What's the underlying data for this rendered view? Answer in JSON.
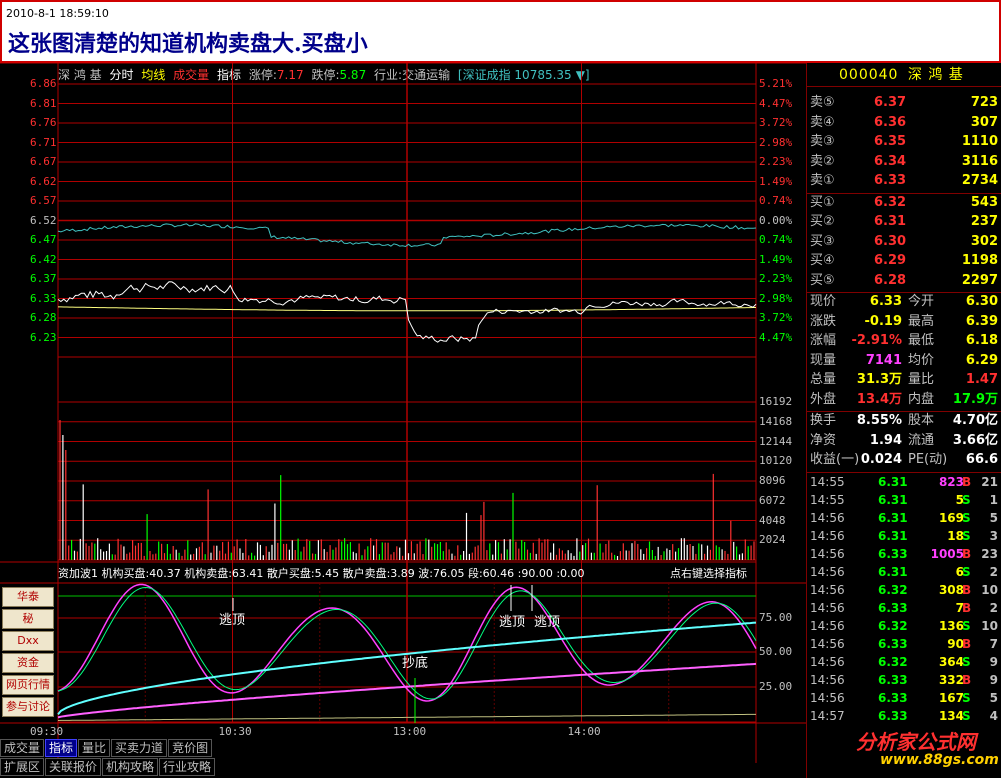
{
  "banner": {
    "timestamp": "2010-8-1 18:59:10",
    "headline": "这张图清楚的知道机构卖盘大.买盘小"
  },
  "chart_title": {
    "stock_name": "深 鸿 基",
    "mode": "分时",
    "items": [
      "均线",
      "成交量",
      "指标"
    ],
    "limit_up_label": "涨停:",
    "limit_up": "7.17",
    "limit_down_label": "跌停:",
    "limit_down": "5.87",
    "industry": "行业:交通运输",
    "index_label": "[深证成指",
    "index_value": "10785.35",
    "index_arrow": "▼]"
  },
  "price_axis": {
    "left": [
      "6.86",
      "6.81",
      "6.76",
      "6.71",
      "6.67",
      "6.62",
      "6.57",
      "6.52",
      "6.47",
      "6.42",
      "6.37",
      "6.33",
      "6.28",
      "6.23"
    ],
    "right": [
      "5.21%",
      "4.47%",
      "3.72%",
      "2.98%",
      "2.23%",
      "1.49%",
      "0.74%",
      "0.00%",
      "0.74%",
      "1.49%",
      "2.23%",
      "2.98%",
      "3.72%",
      "4.47%"
    ]
  },
  "volume_axis": [
    "16192",
    "14168",
    "12144",
    "10120",
    "8096",
    "6072",
    "4048",
    "2024"
  ],
  "indicator": {
    "header": "资加波1  机构买盘:40.37  机构卖盘:63.41  散户买盘:5.45  散户卖盘:3.89  波:76.05  段:60.46  :90.00  :0.00",
    "hint": "点右键选择指标",
    "axis": [
      "75.00",
      "50.00",
      "25.00"
    ],
    "annotations": [
      "逃顶",
      "逃顶",
      "逃顶",
      "抄底"
    ]
  },
  "time_axis": [
    "09:30",
    "10:30",
    "13:00",
    "14:00"
  ],
  "left_buttons": [
    "华泰",
    "秘",
    "Dxx",
    "资金",
    "网页行情",
    "参与讨论"
  ],
  "quote": {
    "code": "000040",
    "name": "深 鸿 基",
    "asks": [
      {
        "label": "卖⑤",
        "price": "6.37",
        "vol": "723"
      },
      {
        "label": "卖④",
        "price": "6.36",
        "vol": "307"
      },
      {
        "label": "卖③",
        "price": "6.35",
        "vol": "1110"
      },
      {
        "label": "卖②",
        "price": "6.34",
        "vol": "3116"
      },
      {
        "label": "卖①",
        "price": "6.33",
        "vol": "2734"
      }
    ],
    "bids": [
      {
        "label": "买①",
        "price": "6.32",
        "vol": "543"
      },
      {
        "label": "买②",
        "price": "6.31",
        "vol": "237"
      },
      {
        "label": "买③",
        "price": "6.30",
        "vol": "302"
      },
      {
        "label": "买④",
        "price": "6.29",
        "vol": "1198"
      },
      {
        "label": "买⑤",
        "price": "6.28",
        "vol": "2297"
      }
    ],
    "stats": [
      {
        "l1": "现价",
        "v1": "6.33",
        "c1": "#ffff00",
        "l2": "今开",
        "v2": "6.30",
        "c2": "#ffff00"
      },
      {
        "l1": "涨跌",
        "v1": "-0.19",
        "c1": "#ffff00",
        "l2": "最高",
        "v2": "6.39",
        "c2": "#ffff00"
      },
      {
        "l1": "涨幅",
        "v1": "-2.91%",
        "c1": "#ff3030",
        "l2": "最低",
        "v2": "6.18",
        "c2": "#ffff00"
      },
      {
        "l1": "现量",
        "v1": "7141",
        "c1": "#ff40ff",
        "l2": "均价",
        "v2": "6.29",
        "c2": "#ffff00"
      },
      {
        "l1": "总量",
        "v1": "31.3万",
        "c1": "#ffff00",
        "l2": "量比",
        "v2": "1.47",
        "c2": "#ff3030"
      },
      {
        "l1": "外盘",
        "v1": "13.4万",
        "c1": "#ff3030",
        "l2": "内盘",
        "v2": "17.9万",
        "c2": "#00ff00"
      }
    ],
    "stats2": [
      {
        "l1": "换手",
        "v1": "8.55%",
        "l2": "股本",
        "v2": "4.70亿"
      },
      {
        "l1": "净资",
        "v1": "1.94",
        "l2": "流通",
        "v2": "3.66亿"
      },
      {
        "l1": "收益(一)",
        "v1": "0.024",
        "l2": "PE(动)",
        "v2": "66.6"
      }
    ],
    "ticks": [
      {
        "t": "14:55",
        "p": "6.31",
        "v": "823",
        "bs": "B",
        "n": "21",
        "vc": "#ff40ff"
      },
      {
        "t": "14:55",
        "p": "6.31",
        "v": "5",
        "bs": "S",
        "n": "1",
        "vc": "#ffff00"
      },
      {
        "t": "14:56",
        "p": "6.31",
        "v": "169",
        "bs": "S",
        "n": "5",
        "vc": "#ffff00"
      },
      {
        "t": "14:56",
        "p": "6.31",
        "v": "18",
        "bs": "S",
        "n": "3",
        "vc": "#ffff00"
      },
      {
        "t": "14:56",
        "p": "6.33",
        "v": "1005",
        "bs": "B",
        "n": "23",
        "vc": "#ff40ff"
      },
      {
        "t": "14:56",
        "p": "6.31",
        "v": "6",
        "bs": "S",
        "n": "2",
        "vc": "#ffff00"
      },
      {
        "t": "14:56",
        "p": "6.32",
        "v": "308",
        "bs": "B",
        "n": "10",
        "vc": "#ffff00"
      },
      {
        "t": "14:56",
        "p": "6.33",
        "v": "7",
        "bs": "B",
        "n": "2",
        "vc": "#ffff00"
      },
      {
        "t": "14:56",
        "p": "6.32",
        "v": "136",
        "bs": "S",
        "n": "10",
        "vc": "#ffff00"
      },
      {
        "t": "14:56",
        "p": "6.33",
        "v": "90",
        "bs": "B",
        "n": "7",
        "vc": "#ffff00"
      },
      {
        "t": "14:56",
        "p": "6.32",
        "v": "364",
        "bs": "S",
        "n": "9",
        "vc": "#ffff00"
      },
      {
        "t": "14:56",
        "p": "6.33",
        "v": "332",
        "bs": "B",
        "n": "9",
        "vc": "#ffff00"
      },
      {
        "t": "14:56",
        "p": "6.33",
        "v": "167",
        "bs": "S",
        "n": "5",
        "vc": "#ffff00"
      },
      {
        "t": "14:57",
        "p": "6.33",
        "v": "134",
        "bs": "S",
        "n": "4",
        "vc": "#ffff00"
      }
    ]
  },
  "tabs_row1": [
    "成交量",
    "指标",
    "量比",
    "买卖力道",
    "竞价图"
  ],
  "tabs_row2": [
    "扩展区",
    "关联报价",
    "机构攻略",
    "行业攻略"
  ],
  "watermark": {
    "line1": "分析家公式网",
    "line2": "www.88gs.com"
  },
  "colors": {
    "grid": "#b00000",
    "price": "#ffffff",
    "avg": "#ffff80",
    "index": "#40c0c0",
    "up": "#ff3030",
    "down": "#00ff00"
  }
}
